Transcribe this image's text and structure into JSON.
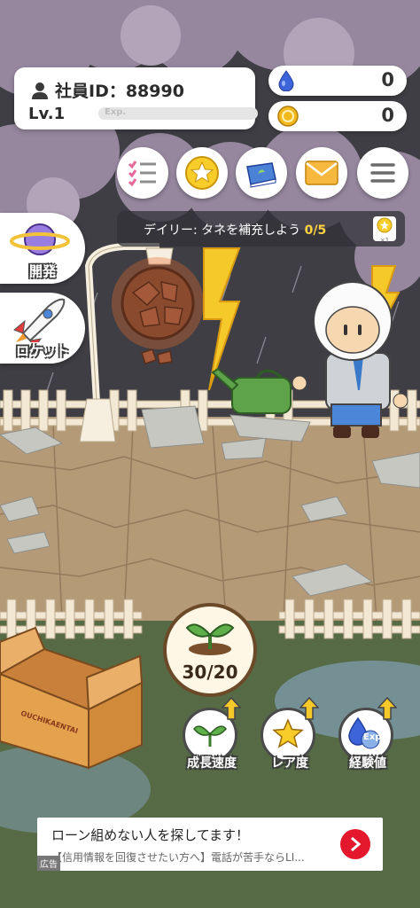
{
  "profile": {
    "employee_id_label": "社員ID：88990",
    "level": "Lv.1",
    "exp_label": "Exp.",
    "exp_progress": 0
  },
  "currencies": [
    {
      "name": "water-drop",
      "value": "0",
      "color": "#3d64d8"
    },
    {
      "name": "coin",
      "value": "0",
      "color": "#f2b81e"
    }
  ],
  "menu_buttons": [
    "list-icon",
    "star-medal-icon",
    "book-icon",
    "mail-icon",
    "hamburger-menu-icon"
  ],
  "daily_task": {
    "text": "デイリー: タネを補充しよう",
    "progress": "0/5",
    "reward_multiplier": "×1"
  },
  "side_buttons": [
    {
      "label": "開発",
      "icon": "planet-icon"
    },
    {
      "label": "ロケット",
      "icon": "rocket-icon"
    }
  ],
  "seed": {
    "count": "30/20"
  },
  "upgrades": [
    {
      "label": "成長速度",
      "icon": "sprout-icon"
    },
    {
      "label": "レア度",
      "icon": "star-icon"
    },
    {
      "label": "経験値",
      "icon": "exp-drop-icon",
      "badge": "Exp"
    }
  ],
  "box_text": "OUCHIKAENTAI",
  "ad": {
    "title": "ローン組めない人を探してます！",
    "subtitle": "【信用情報を回復させたい方へ】電話が苦手ならLI...",
    "tag": "広告"
  },
  "colors": {
    "sky": "#3e3e44",
    "cloud": "#9a8aa0",
    "ground": "#b79a78",
    "grass": "#566b45",
    "fence": "#f4ead6",
    "accent_yellow": "#ffd23f"
  }
}
